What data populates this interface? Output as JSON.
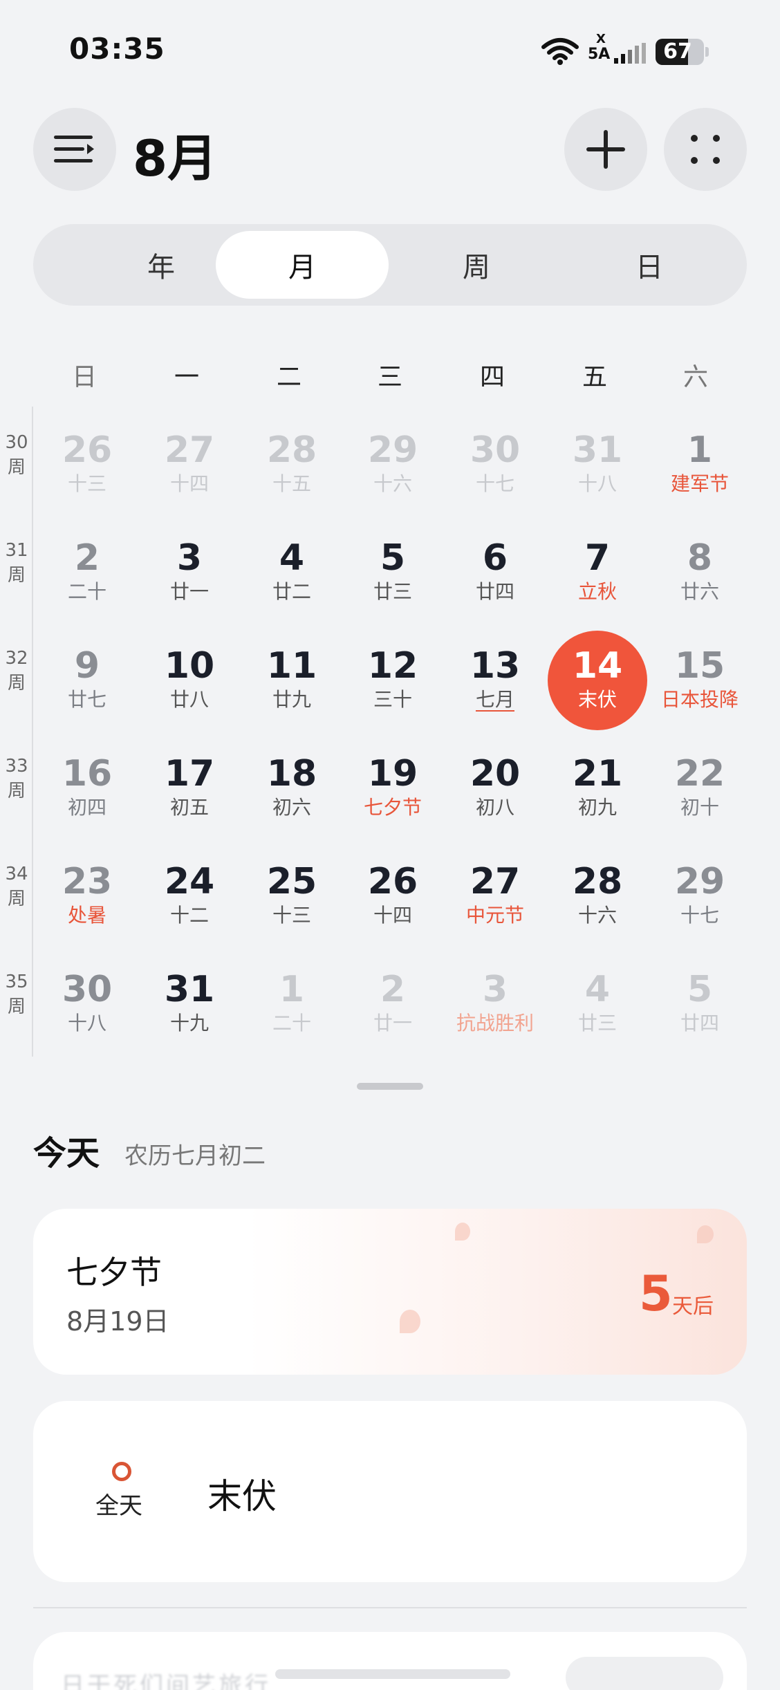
{
  "status_bar": {
    "time": "03:35",
    "network_label": "5A",
    "network_x": "X",
    "battery": "67",
    "battery_level": 0.67
  },
  "header": {
    "month_title": "8月",
    "menu_icon": "menu-arrow-icon",
    "add_icon": "plus-icon",
    "more_icon": "four-dots-icon"
  },
  "view_tabs": [
    {
      "label": "年",
      "active": false
    },
    {
      "label": "月",
      "active": true
    },
    {
      "label": "周",
      "active": false
    },
    {
      "label": "日",
      "active": false
    }
  ],
  "weekdays": [
    "日",
    "一",
    "二",
    "三",
    "四",
    "五",
    "六"
  ],
  "weeks": [
    {
      "week_no": "30",
      "week_suffix": "周",
      "days": [
        {
          "day": "26",
          "lunar": "十三",
          "other": true
        },
        {
          "day": "27",
          "lunar": "十四",
          "other": true
        },
        {
          "day": "28",
          "lunar": "十五",
          "other": true
        },
        {
          "day": "29",
          "lunar": "十六",
          "other": true
        },
        {
          "day": "30",
          "lunar": "十七",
          "other": true
        },
        {
          "day": "31",
          "lunar": "十八",
          "other": true
        },
        {
          "day": "1",
          "lunar": "建军节",
          "holiday": true
        }
      ]
    },
    {
      "week_no": "31",
      "week_suffix": "周",
      "days": [
        {
          "day": "2",
          "lunar": "二十"
        },
        {
          "day": "3",
          "lunar": "廿一"
        },
        {
          "day": "4",
          "lunar": "廿二"
        },
        {
          "day": "5",
          "lunar": "廿三"
        },
        {
          "day": "6",
          "lunar": "廿四"
        },
        {
          "day": "7",
          "lunar": "立秋",
          "holiday": true
        },
        {
          "day": "8",
          "lunar": "廿六"
        }
      ]
    },
    {
      "week_no": "32",
      "week_suffix": "周",
      "days": [
        {
          "day": "9",
          "lunar": "廿七"
        },
        {
          "day": "10",
          "lunar": "廿八"
        },
        {
          "day": "11",
          "lunar": "廿九"
        },
        {
          "day": "12",
          "lunar": "三十"
        },
        {
          "day": "13",
          "lunar": "七月",
          "underline": true
        },
        {
          "day": "14",
          "lunar": "末伏",
          "today": true
        },
        {
          "day": "15",
          "lunar": "日本投降",
          "holiday": true
        }
      ]
    },
    {
      "week_no": "33",
      "week_suffix": "周",
      "days": [
        {
          "day": "16",
          "lunar": "初四"
        },
        {
          "day": "17",
          "lunar": "初五"
        },
        {
          "day": "18",
          "lunar": "初六"
        },
        {
          "day": "19",
          "lunar": "七夕节",
          "holiday": true
        },
        {
          "day": "20",
          "lunar": "初八"
        },
        {
          "day": "21",
          "lunar": "初九"
        },
        {
          "day": "22",
          "lunar": "初十"
        }
      ]
    },
    {
      "week_no": "34",
      "week_suffix": "周",
      "days": [
        {
          "day": "23",
          "lunar": "处暑",
          "holiday": true
        },
        {
          "day": "24",
          "lunar": "十二"
        },
        {
          "day": "25",
          "lunar": "十三"
        },
        {
          "day": "26",
          "lunar": "十四"
        },
        {
          "day": "27",
          "lunar": "中元节",
          "holiday": true
        },
        {
          "day": "28",
          "lunar": "十六"
        },
        {
          "day": "29",
          "lunar": "十七"
        }
      ]
    },
    {
      "week_no": "35",
      "week_suffix": "周",
      "days": [
        {
          "day": "30",
          "lunar": "十八"
        },
        {
          "day": "31",
          "lunar": "十九"
        },
        {
          "day": "1",
          "lunar": "二十",
          "other": true
        },
        {
          "day": "2",
          "lunar": "廿一",
          "other": true
        },
        {
          "day": "3",
          "lunar": "抗战胜利",
          "other": true,
          "holiday": true
        },
        {
          "day": "4",
          "lunar": "廿三",
          "other": true
        },
        {
          "day": "5",
          "lunar": "廿四",
          "other": true
        }
      ]
    }
  ],
  "today": {
    "title": "今天",
    "lunar_date": "农历七月初二"
  },
  "festival_card": {
    "name": "七夕节",
    "date": "8月19日",
    "countdown": "5",
    "countdown_unit": "天后",
    "accent": "#ea5a3a"
  },
  "event_card": {
    "time_label": "全天",
    "title": "末伏"
  },
  "partial_card": {
    "text": "日干死们间艺旅行"
  },
  "colors": {
    "accent": "#f0553b",
    "holiday": "#e8553a",
    "background": "#f2f3f5"
  }
}
